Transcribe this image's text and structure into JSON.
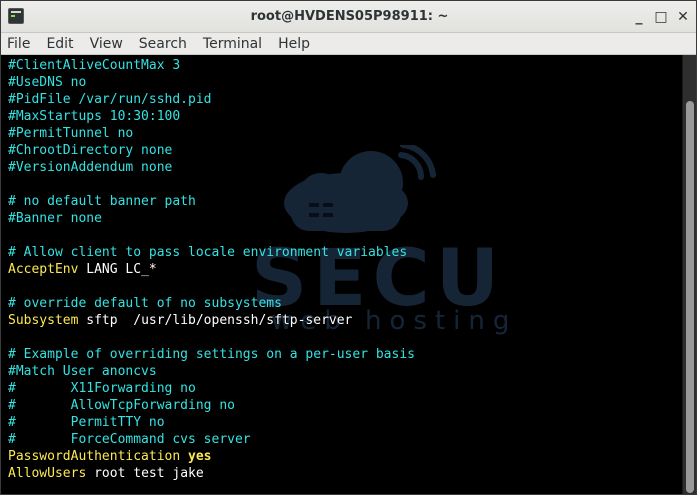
{
  "window": {
    "title": "root@HVDENS05P98911: ~",
    "minimize": "_",
    "maximize": "□",
    "close": "✕"
  },
  "menu": [
    "File",
    "Edit",
    "View",
    "Search",
    "Terminal",
    "Help"
  ],
  "watermark": {
    "line1": "SECU",
    "line2": "web hosting"
  },
  "scrollbar": {
    "position_fraction": 1.0,
    "visible_fraction": 0.9
  },
  "lines": [
    [
      {
        "t": "#ClientAliveCountMax 3",
        "c": "cyan"
      }
    ],
    [
      {
        "t": "#UseDNS no",
        "c": "cyan"
      }
    ],
    [
      {
        "t": "#PidFile /var/run/sshd.pid",
        "c": "cyan"
      }
    ],
    [
      {
        "t": "#MaxStartups 10:30:100",
        "c": "cyan"
      }
    ],
    [
      {
        "t": "#PermitTunnel no",
        "c": "cyan"
      }
    ],
    [
      {
        "t": "#ChrootDirectory none",
        "c": "cyan"
      }
    ],
    [
      {
        "t": "#VersionAddendum none",
        "c": "cyan"
      }
    ],
    [],
    [
      {
        "t": "# no default banner path",
        "c": "cyan"
      }
    ],
    [
      {
        "t": "#Banner none",
        "c": "cyan"
      }
    ],
    [],
    [
      {
        "t": "# Allow client to pass locale environment variables",
        "c": "cyan"
      }
    ],
    [
      {
        "t": "AcceptEnv",
        "c": "yellow"
      },
      {
        "t": " LANG LC_*",
        "c": "white"
      }
    ],
    [],
    [
      {
        "t": "# override default of no subsystems",
        "c": "cyan"
      }
    ],
    [
      {
        "t": "Subsystem",
        "c": "yellow"
      },
      {
        "t": " sftp  /usr/lib/openssh/sftp-server",
        "c": "white"
      }
    ],
    [],
    [
      {
        "t": "# Example of overriding settings on a per-user basis",
        "c": "cyan"
      }
    ],
    [
      {
        "t": "#Match User anoncvs",
        "c": "cyan"
      }
    ],
    [
      {
        "t": "#       X11Forwarding no",
        "c": "cyan"
      }
    ],
    [
      {
        "t": "#       AllowTcpForwarding no",
        "c": "cyan"
      }
    ],
    [
      {
        "t": "#       PermitTTY no",
        "c": "cyan"
      }
    ],
    [
      {
        "t": "#       ForceCommand cvs server",
        "c": "cyan"
      }
    ],
    [
      {
        "t": "PasswordAuthentication",
        "c": "yellow"
      },
      {
        "t": " ",
        "c": "white"
      },
      {
        "t": "yes",
        "c": "bold-yellow"
      }
    ],
    [
      {
        "t": "AllowUsers",
        "c": "yellow"
      },
      {
        "t": " root test jake",
        "c": "white"
      }
    ]
  ]
}
